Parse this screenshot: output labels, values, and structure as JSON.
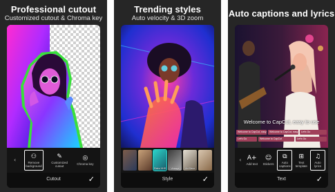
{
  "panels": [
    {
      "title": "Professional cutout",
      "subtitle": "Customized cutout & Chroma key",
      "toolbar": {
        "items": [
          {
            "label": "Remove background",
            "icon": "person-cutout-icon"
          },
          {
            "label": "Customized cutout",
            "icon": "brush-icon"
          },
          {
            "label": "Chroma key",
            "icon": "chroma-icon"
          }
        ]
      },
      "bottom_label": "Cutout"
    },
    {
      "title": "Trending styles",
      "subtitle": "Auto velocity & 3D zoom",
      "styles": [
        "",
        "",
        "Retro VHS",
        "Vintage",
        "Art Deco",
        ""
      ],
      "selected_style_index": 2,
      "bottom_label": "Style"
    },
    {
      "title": "Auto captions and lyrics",
      "caption": "Welcome to CapCut, easy to use",
      "caption_chips": [
        "Welcome to CapCut, easy to use",
        "Welcome to CapCut, easy to use",
        "Let's Go",
        "Let's Go",
        "Welcome to CapCut",
        "Let's Go"
      ],
      "toolbar": {
        "items": [
          {
            "label": "Add text",
            "icon": "text-add-icon"
          },
          {
            "label": "Stickers",
            "icon": "sticker-icon"
          },
          {
            "label": "Auto captions",
            "icon": "auto-captions-icon"
          },
          {
            "label": "Text template",
            "icon": "text-template-icon"
          },
          {
            "label": "Auto lyrics",
            "icon": "auto-lyrics-icon"
          }
        ]
      },
      "bottom_label": "Text"
    }
  ],
  "colors": {
    "panel_bg": "#262626",
    "accent_teal": "#2bd4c9",
    "caption_chip": "#a0405a",
    "cutout_outline": "#39e03c"
  }
}
